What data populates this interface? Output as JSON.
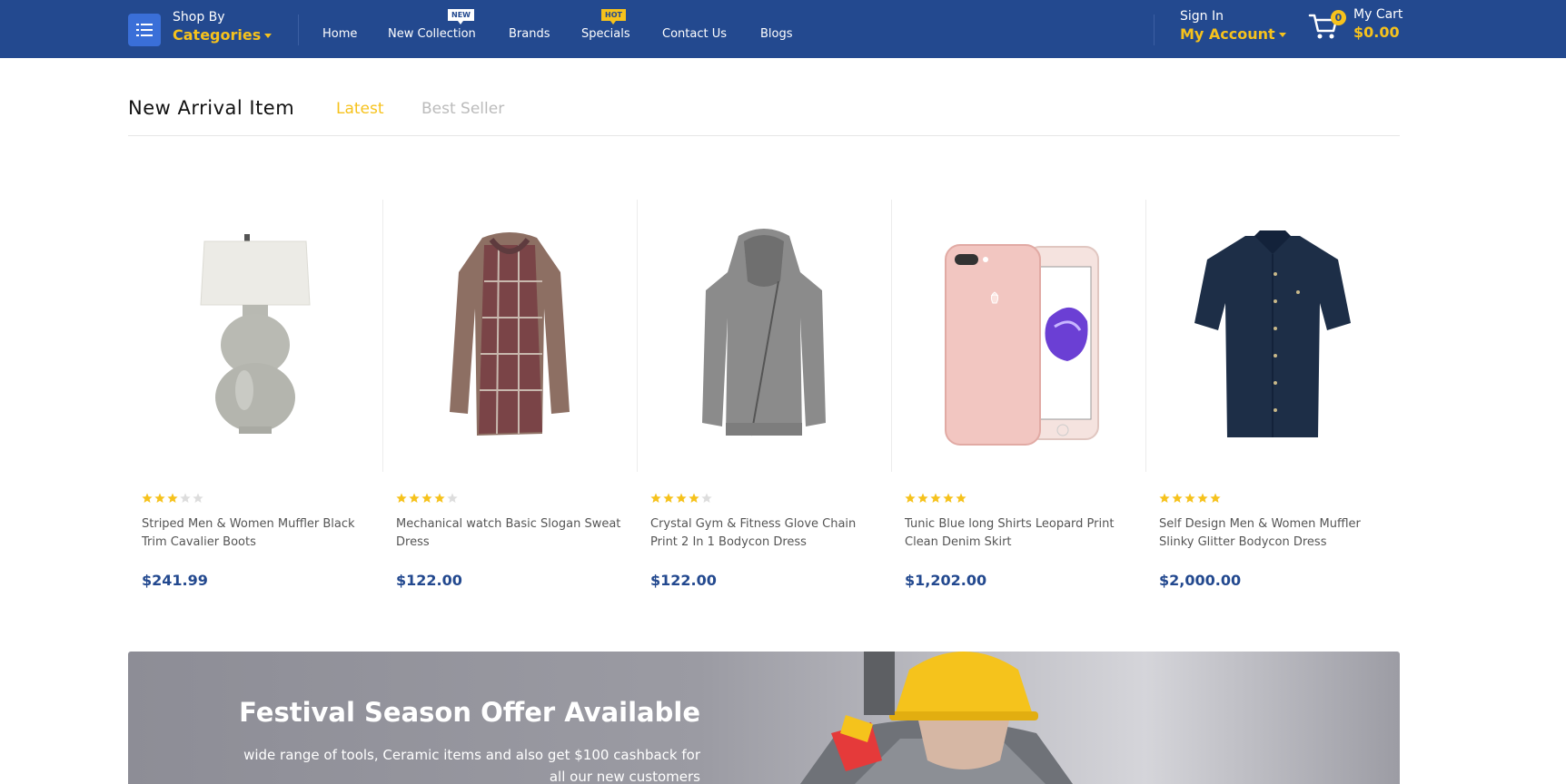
{
  "header": {
    "categories": {
      "small": "Shop By",
      "big": "Categories",
      "icon": "list-icon"
    },
    "nav": [
      {
        "label": "Home"
      },
      {
        "label": "New Collection",
        "tag": "NEW"
      },
      {
        "label": "Brands"
      },
      {
        "label": "Specials",
        "tag": "HOT"
      },
      {
        "label": "Contact Us"
      },
      {
        "label": "Blogs"
      }
    ],
    "account": {
      "small": "Sign In",
      "big": "My Account"
    },
    "cart": {
      "small": "My Cart",
      "total": "$0.00",
      "count": "0",
      "icon": "cart-icon"
    }
  },
  "section": {
    "title": "New Arrival Item",
    "tabs": [
      {
        "label": "Latest",
        "active": true
      },
      {
        "label": "Best Seller",
        "active": false
      }
    ]
  },
  "products": [
    {
      "name": "Striped Men & Women Muffler Black Trim Cavalier Boots",
      "price": "$241.99",
      "rating": 3,
      "image": "table-lamp"
    },
    {
      "name": "Mechanical watch Basic Slogan Sweat Dress",
      "price": "$122.00",
      "rating": 4,
      "image": "plaid-cardigan"
    },
    {
      "name": "Crystal Gym & Fitness Glove Chain Print 2 In 1 Bodycon Dress",
      "price": "$122.00",
      "rating": 4,
      "image": "grey-hoodie"
    },
    {
      "name": "Tunic Blue long Shirts Leopard Print Clean Denim Skirt",
      "price": "$1,202.00",
      "rating": 5,
      "image": "rose-gold-phone"
    },
    {
      "name": "Self Design Men & Women Muffler Slinky Glitter Bodycon Dress",
      "price": "$2,000.00",
      "rating": 5,
      "image": "navy-shirt"
    }
  ],
  "banner": {
    "title": "Festival Season Offer Available",
    "subtitle": "wide range of tools, Ceramic items and also get $100 cashback for all our new customers",
    "image": "construction-worker"
  },
  "colors": {
    "primary": "#23498f",
    "accent": "#f6c21c",
    "star_off": "#dddddd"
  }
}
